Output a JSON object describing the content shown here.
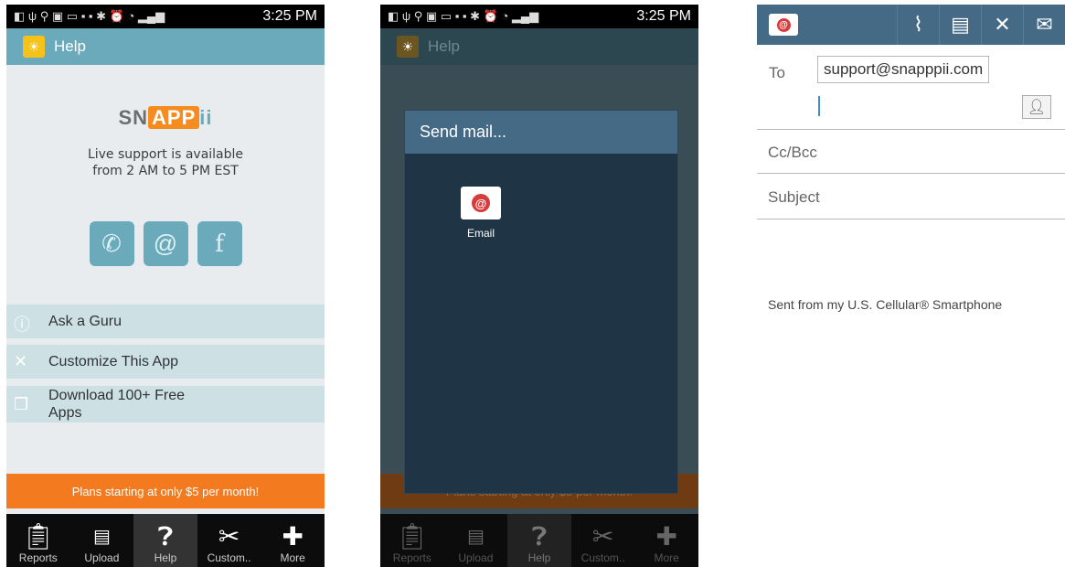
{
  "status_bar": {
    "time": "3:25 PM"
  },
  "screen1": {
    "header_title": "Help",
    "logo": {
      "left": "SN",
      "middle": "APP",
      "right": "ii"
    },
    "support_lines": [
      "Live support is available",
      "from 2 AM to 5 PM EST"
    ],
    "menu": [
      {
        "icon": "question-circle-icon",
        "label": "Ask a Guru"
      },
      {
        "icon": "tools-icon",
        "label": "Customize This App"
      },
      {
        "icon": "layers-icon",
        "label_line1": "Download 100+ Free",
        "label_line2": "Apps"
      }
    ],
    "promo": "Plans starting at only $5 per month!",
    "tabs": [
      {
        "icon": "clipboard-icon",
        "label": "Reports"
      },
      {
        "icon": "pdf-icon",
        "label": "Upload"
      },
      {
        "icon": "help-icon",
        "label": "Help",
        "active": true
      },
      {
        "icon": "tools-icon",
        "label": "Custom.."
      },
      {
        "icon": "plus-icon",
        "label": "More"
      }
    ]
  },
  "screen2": {
    "dialog_title": "Send mail...",
    "option_label": "Email"
  },
  "screen3": {
    "to_label": "To",
    "to_value": "support@snapppii.com",
    "cc_label": "Cc/Bcc",
    "subject_label": "Subject",
    "signature": "Sent from my U.S. Cellular® Smartphone"
  },
  "colors": {
    "accent": "#6aaabb",
    "promo": "#f47a20",
    "dialog_header": "#456a85"
  }
}
